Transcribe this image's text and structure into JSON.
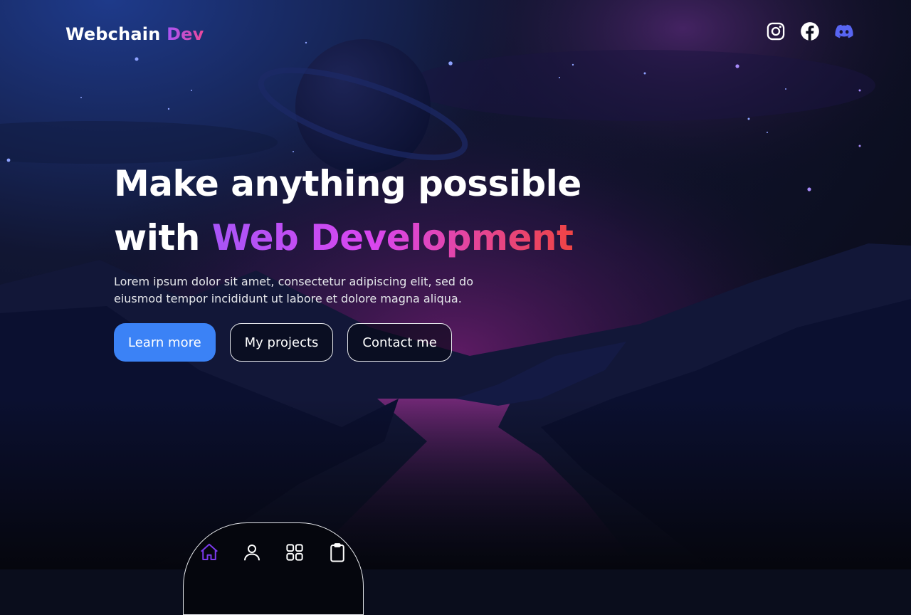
{
  "brand": {
    "name": "Webchain",
    "accent": "Dev"
  },
  "social": [
    {
      "name": "instagram-icon"
    },
    {
      "name": "facebook-icon"
    },
    {
      "name": "discord-icon"
    }
  ],
  "hero": {
    "line1": "Make anything possible",
    "line2_prefix": "with ",
    "line2_highlight": "Web Development",
    "description": "Lorem ipsum dolor sit amet, consectetur adipiscing elit, sed do eiusmod tempor incididunt ut labore et dolore magna aliqua."
  },
  "buttons": {
    "learn_more": "Learn more",
    "my_projects": "My projects",
    "contact_me": "Contact me"
  },
  "dock": {
    "items": [
      "home-icon",
      "user-icon",
      "grid-icon",
      "clipboard-icon"
    ],
    "active": "home-icon"
  },
  "colors": {
    "primary_button": "#3b82f6",
    "gradient_start": "#a855f7",
    "gradient_end": "#ef4444",
    "discord": "#5865f2",
    "dock_active": "#7c3aed"
  }
}
